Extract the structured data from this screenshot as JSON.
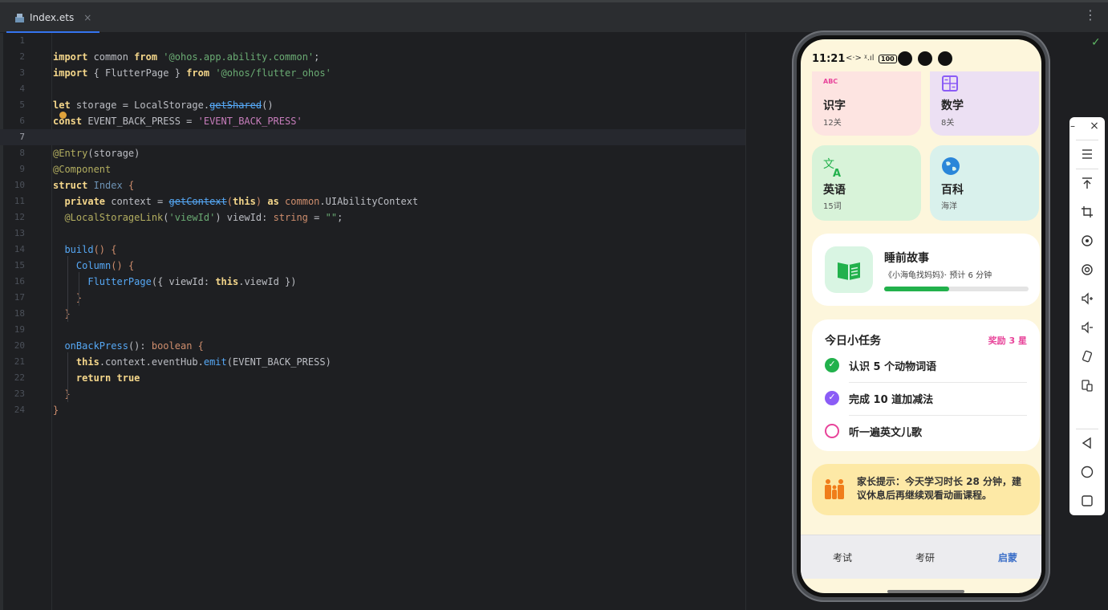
{
  "tab": {
    "filename": "Index.ets",
    "close": "×"
  },
  "menu_icon": "⋮",
  "editor": {
    "lines": [
      {
        "n": "1"
      },
      {
        "n": "2"
      },
      {
        "n": "3"
      },
      {
        "n": "4"
      },
      {
        "n": "5"
      },
      {
        "n": "6"
      },
      {
        "n": "7"
      },
      {
        "n": "8"
      },
      {
        "n": "9"
      },
      {
        "n": "10"
      },
      {
        "n": "11"
      },
      {
        "n": "12"
      },
      {
        "n": "13"
      },
      {
        "n": "14"
      },
      {
        "n": "15"
      },
      {
        "n": "16"
      },
      {
        "n": "17"
      },
      {
        "n": "18"
      },
      {
        "n": "19"
      },
      {
        "n": "20"
      },
      {
        "n": "21"
      },
      {
        "n": "22"
      },
      {
        "n": "23"
      },
      {
        "n": "24"
      }
    ],
    "tokens": {
      "l2": [
        "import",
        " common ",
        "from",
        " ",
        "'@ohos.app.ability.common'",
        ";"
      ],
      "l3": [
        "import",
        " { FlutterPage } ",
        "from",
        " ",
        "'@ohos/flutter_ohos'"
      ],
      "l5": [
        "let",
        " storage = LocalStorage.",
        "getShared",
        "()"
      ],
      "l6": [
        "const",
        " EVENT_BACK_PRESS = ",
        "'EVENT_BACK_PRESS'"
      ],
      "l8": [
        "@Entry",
        "(storage)"
      ],
      "l9": [
        "@Component"
      ],
      "l10": [
        "struct",
        " ",
        "Index",
        " {"
      ],
      "l11": [
        "  ",
        "private",
        " context = ",
        "getContext",
        "(",
        "this",
        ") ",
        "as",
        " ",
        "common",
        ".UIAbilityContext"
      ],
      "l12": [
        "  ",
        "@LocalStorageLink",
        "(",
        "'viewId'",
        ") viewId: ",
        "string",
        " = ",
        "\"\"",
        ";"
      ],
      "l14": [
        "  ",
        "build",
        "() {"
      ],
      "l15": [
        "    ",
        "Column",
        "() {"
      ],
      "l16": [
        "      ",
        "FlutterPage",
        "({ viewId: ",
        "this",
        ".viewId })"
      ],
      "l17": [
        "    }"
      ],
      "l18": [
        "  }"
      ],
      "l20": [
        "  ",
        "onBackPress",
        "(): ",
        "boolean",
        " {"
      ],
      "l21": [
        "    ",
        "this",
        ".context.eventHub.",
        "emit",
        "(EVENT_BACK_PRESS)"
      ],
      "l22": [
        "    ",
        "return",
        " ",
        "true"
      ],
      "l23": [
        "  }"
      ],
      "l24": [
        "}"
      ]
    }
  },
  "check_icon": "✓",
  "phone": {
    "status": {
      "time": "11:21",
      "icons": "<·> ᵡ.ıl",
      "battery": "100"
    },
    "categories": [
      {
        "title": "识字",
        "sub": "12关",
        "icon_label": "ABC",
        "color": "#fde4e1"
      },
      {
        "title": "数学",
        "sub": "8关",
        "color": "#ece0f3"
      },
      {
        "title": "英语",
        "sub": "15词",
        "color": "#d8f3d9"
      },
      {
        "title": "百科",
        "sub": "海洋",
        "color": "#d9f1ec"
      }
    ],
    "story": {
      "title": "睡前故事",
      "sub": "《小海龟找妈妈》· 预计 6 分钟",
      "progress": 0.45
    },
    "tasks": {
      "title": "今日小任务",
      "reward": "奖励 3 星",
      "items": [
        {
          "label": "认识 5 个动物词语",
          "state": "done",
          "color": "#22b14c"
        },
        {
          "label": "完成 10 道加减法",
          "state": "done",
          "color": "#8b5cf6"
        },
        {
          "label": "听一遍英文儿歌",
          "state": "todo",
          "color": "#e8449a"
        }
      ]
    },
    "tip": {
      "text": "家长提示：今天学习时长 28 分钟，建议休息后再继续观看动画课程。"
    },
    "tabs": [
      "考试",
      "考研",
      "启蒙"
    ]
  },
  "sidepanel": {
    "minimize": "–",
    "close": "×"
  }
}
